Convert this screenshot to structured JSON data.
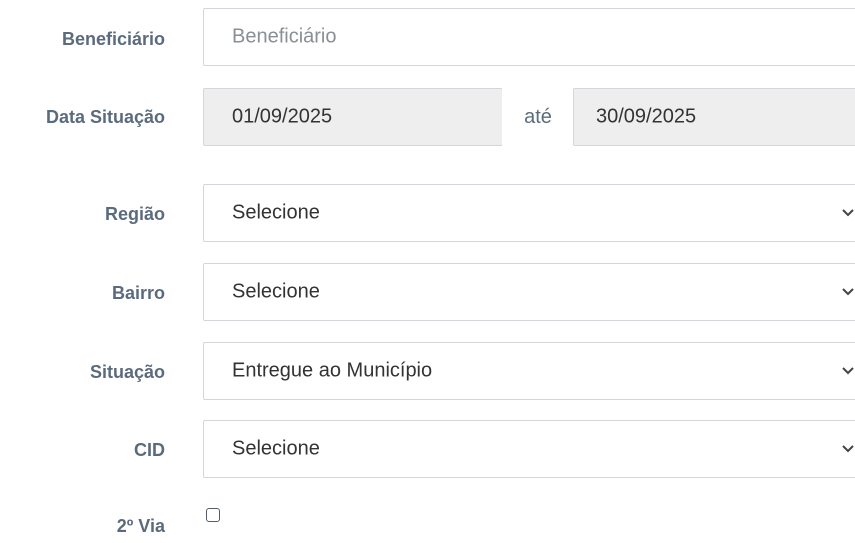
{
  "beneficiario": {
    "label": "Beneficiário",
    "placeholder": "Beneficiário"
  },
  "data_situacao": {
    "label": "Data Situação",
    "from_value": "01/09/2025",
    "separator": "até",
    "to_value": "30/09/2025"
  },
  "regiao": {
    "label": "Região",
    "selected": "Selecione"
  },
  "bairro": {
    "label": "Bairro",
    "selected": "Selecione"
  },
  "situacao": {
    "label": "Situação",
    "selected": "Entregue ao Município"
  },
  "cid": {
    "label": "CID",
    "selected": "Selecione"
  },
  "segunda_via": {
    "label": "2º Via",
    "checked": false
  },
  "icons": {
    "select_arrow": "chevron-down-icon"
  },
  "colors": {
    "label_text": "#5b6b7e",
    "border": "#d3d6da",
    "disabled_bg": "#eeeeee"
  }
}
